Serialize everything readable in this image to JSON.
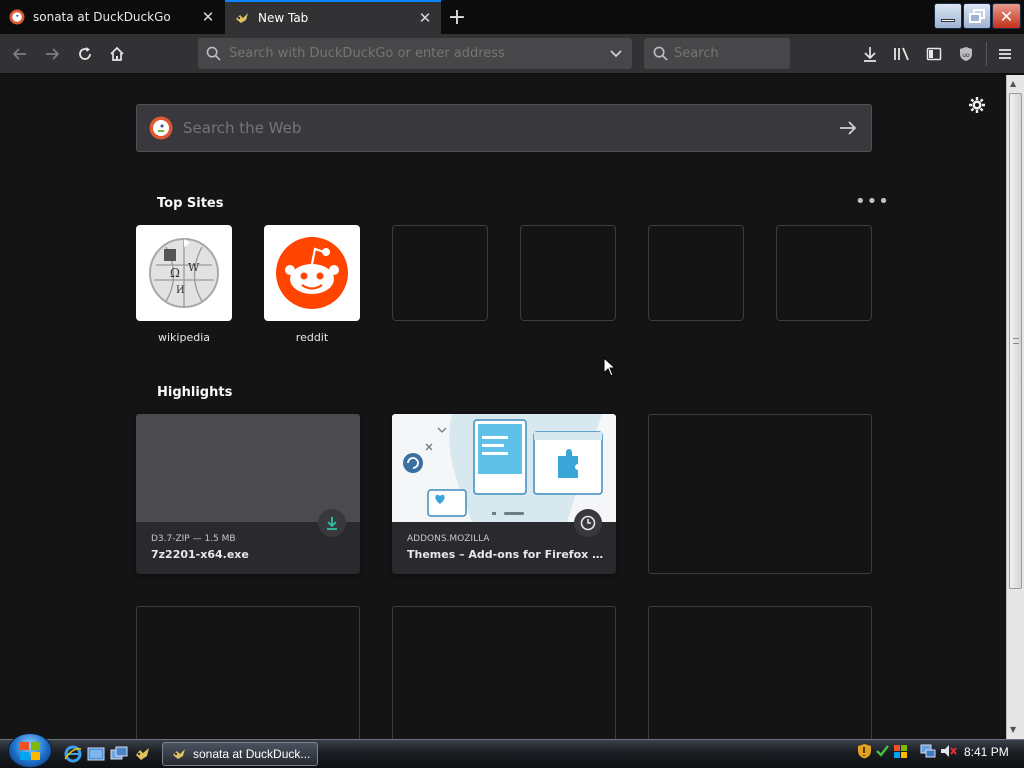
{
  "tabs": [
    {
      "title": "sonata at DuckDuckGo",
      "active": false
    },
    {
      "title": "New Tab",
      "active": true
    }
  ],
  "urlbar": {
    "placeholder": "Search with DuckDuckGo or enter address",
    "value": ""
  },
  "searchbar": {
    "placeholder": "Search"
  },
  "web_search": {
    "placeholder": "Search the Web"
  },
  "top_sites": {
    "title": "Top Sites",
    "sites": [
      {
        "label": "wikipedia",
        "icon": "wikipedia-globe-icon"
      },
      {
        "label": "reddit",
        "icon": "reddit-alien-icon"
      }
    ],
    "empty_slots": 4
  },
  "highlights": {
    "title": "Highlights",
    "cards": [
      {
        "context": "D3.7-ZIP — 1.5 MB",
        "title": "7z2201-x64.exe",
        "badge": "download-icon"
      },
      {
        "context": "ADDONS.MOZILLA",
        "title": "Themes – Add-ons for Firefox (e...",
        "badge": "clock-icon"
      }
    ]
  },
  "taskbar": {
    "active_window": "sonata at DuckDuck...",
    "clock": "8:41 PM"
  },
  "colors": {
    "accent": "#0a84ff",
    "reddit": "#ff4500",
    "download_green": "#2ac3a2"
  }
}
